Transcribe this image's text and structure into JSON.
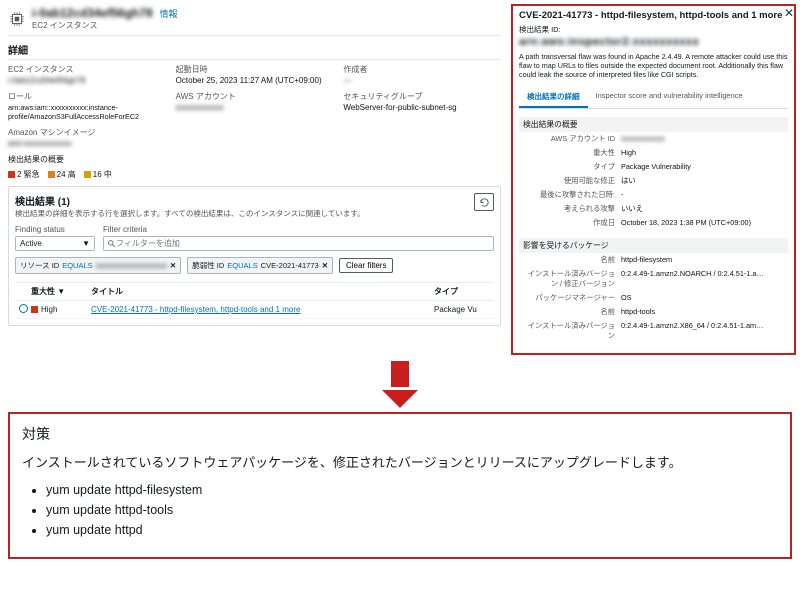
{
  "header": {
    "title_blurred": "i-0ab12cd34ef56gh78",
    "info_link": "情報",
    "subtitle": "EC2 インスタンス"
  },
  "detail": {
    "section_title": "詳細",
    "rows": [
      {
        "a_lbl": "EC2 インスタンス",
        "a_val": "i-0ab12cd34ef56gh78",
        "a_blur": true,
        "b_lbl": "起動日時",
        "b_val": "October 25, 2023 11:27 AM (UTC+09:00)",
        "c_lbl": "作成者",
        "c_val": "—",
        "c_blur": true
      },
      {
        "a_lbl": "ロール",
        "a_val": "arn:aws:iam::xxxxxxxxxx:instance-profile/AmazonS3FullAccessRoleForEC2",
        "b_lbl": "AWS アカウント",
        "b_val": "xxxxxxxxxxxx",
        "b_blur": true,
        "c_lbl": "セキュリティグループ",
        "c_val": "WebServer-for-public-subnet-sg"
      },
      {
        "a_lbl": "Amazon マシンイメージ",
        "a_val": "ami-xxxxxxxxxxxx",
        "a_blur": true,
        "b_lbl": "",
        "b_val": "",
        "c_lbl": "",
        "c_val": ""
      }
    ],
    "findings_summary_label": "検出結果の概要",
    "legend": {
      "critical": "2 緊急",
      "high": "24 高",
      "medium": "16 中"
    }
  },
  "findings": {
    "panel_title": "検出結果 (1)",
    "panel_sub": "検出結果の詳細を表示する行を選択します。すべての検出結果は、このインスタンスに関連しています。",
    "finding_status_label": "Finding status",
    "finding_status_value": "Active",
    "filter_label": "Filter criteria",
    "filter_placeholder": "フィルターを追加",
    "chips": [
      {
        "key": "リソース ID",
        "op": "EQUALS",
        "val": "xxxxxxxxxxxxxxxxxxx",
        "val_blur": true
      },
      {
        "key": "脆弱性 ID",
        "op": "EQUALS",
        "val": "CVE-2021-41773"
      }
    ],
    "clear_label": "Clear filters",
    "columns": {
      "severity": "重大性",
      "title": "タイトル",
      "type": "タイプ"
    },
    "row": {
      "severity": "High",
      "title": "CVE-2021-41773 - httpd-filesystem, httpd-tools and 1 more",
      "type": "Package Vu"
    }
  },
  "side": {
    "title": "CVE-2021-41773 - httpd-filesystem, httpd-tools and 1 more",
    "result_id_label": "検出結果 ID:",
    "result_id_value": "arn:aws:inspector2:xxxxxxxxxx",
    "description": "A path transversal flaw was found in Apache 2.4.49. A remote attacker could use this flaw to map URLs to files outside the expected document root. Additionally this flaw could leak the source of interpreted files like CGI scripts.",
    "tabs": {
      "active": "検出結果の詳細",
      "other": "Inspector score and vulnerability intelligence"
    },
    "summary_title": "検出結果の概要",
    "summary": [
      {
        "k": "AWS アカウント ID",
        "v": "xxxxxxxxxxxx",
        "blur": true
      },
      {
        "k": "重大性",
        "v": "High"
      },
      {
        "k": "タイプ",
        "v": "Package Vulnerability"
      },
      {
        "k": "使用可能な修正",
        "v": "はい"
      },
      {
        "k": "最後に攻撃された日時:",
        "v": "-"
      },
      {
        "k": "考えられる攻撃",
        "v": "いいえ"
      },
      {
        "k": "作成日",
        "v": "October 18, 2023 1:38 PM (UTC+09:00)"
      }
    ],
    "packages_title": "影響を受けるパッケージ",
    "packages": [
      {
        "k": "名前",
        "v": "httpd-filesystem"
      },
      {
        "k": "インストール済みバージョン / 修正バージョン",
        "v": "0:2.4.49-1.amzn2.NOARCH / 0:2.4.51-1.a…"
      },
      {
        "k": "パッケージマネージャー",
        "v": "OS"
      },
      {
        "k": "名前",
        "v": "httpd-tools"
      },
      {
        "k": "インストール済みバージョン",
        "v": "0:2.4.49-1.amzn2.X86_64 / 0:2.4.51-1.am…"
      }
    ]
  },
  "remediation": {
    "heading": "対策",
    "text": "インストールされているソフトウェアパッケージを、修正されたバージョンとリリースにアップグレードします。",
    "commands": [
      "yum update httpd-filesystem",
      "yum update httpd-tools",
      "yum update httpd"
    ]
  }
}
